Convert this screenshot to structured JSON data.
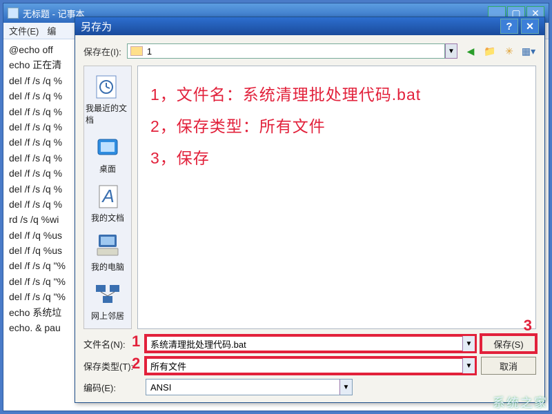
{
  "notepad": {
    "title": "无标题 - 记事本",
    "menu": {
      "file": "文件(E)",
      "edit": "编"
    },
    "content_lines": [
      "@echo off",
      "echo 正在清",
      "del /f /s /q %",
      "del /f /s /q %",
      "del /f /s /q %",
      "del /f /s /q %",
      "del /f /s /q %",
      "del /f /s /q %",
      "del /f /s /q %",
      "del /f /s /q %",
      "del /f /s /q %",
      "rd /s /q %wi",
      "del /f /q %us",
      "del /f /q %us",
      "del /f /s /q \"%",
      "del /f /s /q \"%",
      "del /f /s /q \"%",
      "echo 系统垃",
      "echo. & pau"
    ]
  },
  "saveas": {
    "title": "另存为",
    "help_label": "?",
    "close_label": "×",
    "lookin_label": "保存在(I):",
    "lookin_value": "1",
    "places": {
      "recent": "我最近的文档",
      "desktop": "桌面",
      "mydocs": "我的文档",
      "mypc": "我的电脑",
      "network": "网上邻居"
    },
    "annotations": {
      "line1": "1，文件名：系统清理批处理代码.bat",
      "line2": "2，保存类型：所有文件",
      "line3": "3，保存"
    },
    "filename_label": "文件名(N):",
    "filename_value": "系统清理批处理代码.bat",
    "filetype_label": "保存类型(T):",
    "filetype_value": "所有文件",
    "encoding_label": "编码(E):",
    "encoding_value": "ANSI",
    "save_btn": "保存(S)",
    "cancel_btn": "取消",
    "tags": {
      "t1": "1",
      "t2": "2",
      "t3": "3"
    }
  },
  "watermark": "系统之家"
}
